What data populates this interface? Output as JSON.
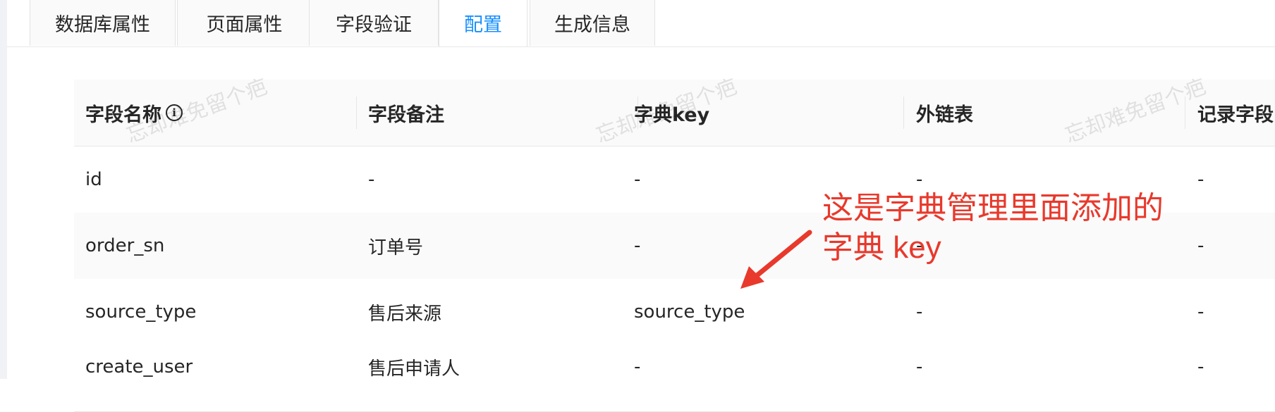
{
  "tabs": [
    {
      "label": "数据库属性",
      "active": false
    },
    {
      "label": "页面属性",
      "active": false
    },
    {
      "label": "字段验证",
      "active": false
    },
    {
      "label": "配置",
      "active": true
    },
    {
      "label": "生成信息",
      "active": false
    }
  ],
  "table": {
    "columns": [
      "字段名称",
      "字段备注",
      "字典key",
      "外链表",
      "记录字段"
    ],
    "rows": [
      [
        "id",
        "-",
        "-",
        "-",
        "-"
      ],
      [
        "order_sn",
        "订单号",
        "-",
        "-",
        "-"
      ],
      [
        "source_type",
        "售后来源",
        "source_type",
        "-",
        "-"
      ],
      [
        "create_user",
        "售后申请人",
        "-",
        "-",
        "-"
      ]
    ]
  },
  "watermark": "忘却难免留个疤",
  "annotation": {
    "line1": "这是字典管理里面添加的",
    "line2": "字典 key",
    "color": "#e8392c"
  },
  "colors": {
    "accent": "#1890ff",
    "header_bg": "#fafafa",
    "border": "#e8e8e8"
  }
}
